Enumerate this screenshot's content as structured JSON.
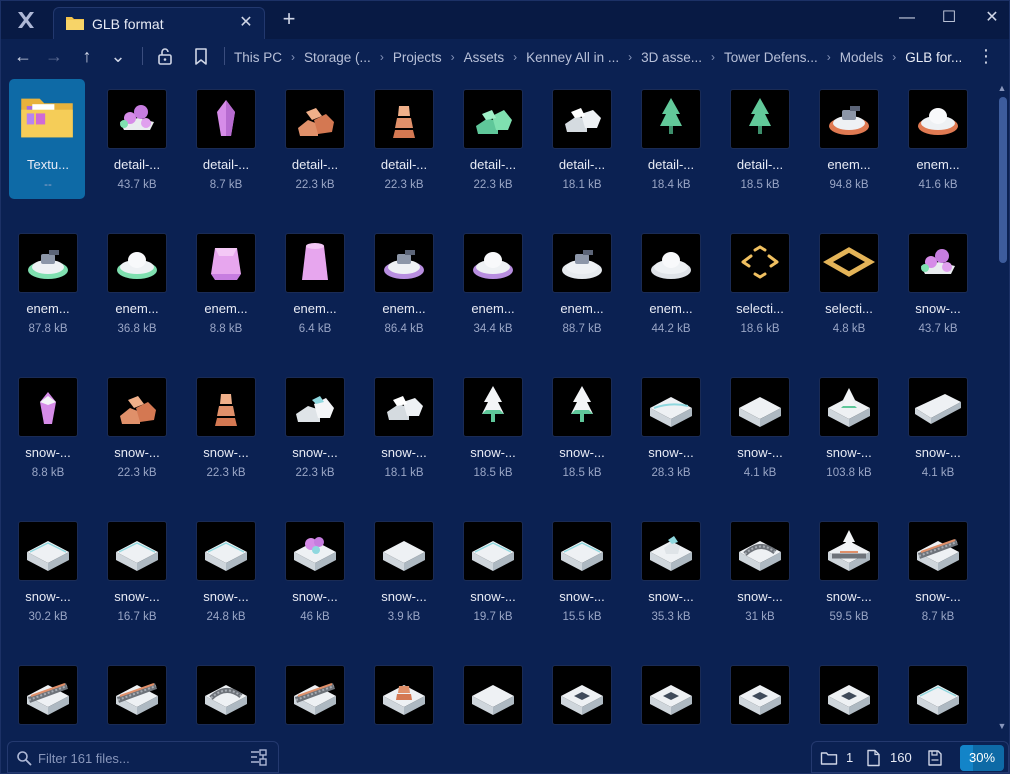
{
  "window": {
    "tab_title": "GLB format",
    "close_tab_glyph": "✕",
    "new_tab_glyph": "+",
    "minimize_glyph": "—",
    "maximize_glyph": "☐",
    "close_glyph": "✕",
    "accent_color": "#0e6aa6",
    "background_color": "#0b2152"
  },
  "toolbar": {
    "back_glyph": "←",
    "forward_glyph": "→",
    "up_glyph": "↑",
    "history_glyph": "⌄",
    "more_glyph": "⋮",
    "breadcrumb": [
      "This PC",
      "Storage (...",
      "Projects",
      "Assets",
      "Kenney All in ...",
      "3D asse...",
      "Tower Defens...",
      "Models",
      "GLB for..."
    ]
  },
  "items": [
    {
      "name": "Textu...",
      "size": "--",
      "kind": "folder",
      "selected": true
    },
    {
      "name": "detail-...",
      "size": "43.7 kB",
      "icon": "crystal-cluster"
    },
    {
      "name": "detail-...",
      "size": "8.7 kB",
      "icon": "crystal"
    },
    {
      "name": "detail-...",
      "size": "22.3 kB",
      "icon": "rocks-orange"
    },
    {
      "name": "detail-...",
      "size": "22.3 kB",
      "icon": "rock-stack-orange"
    },
    {
      "name": "detail-...",
      "size": "22.3 kB",
      "icon": "rocks-green"
    },
    {
      "name": "detail-...",
      "size": "18.1 kB",
      "icon": "rocks-white"
    },
    {
      "name": "detail-...",
      "size": "18.4 kB",
      "icon": "tree-green"
    },
    {
      "name": "detail-...",
      "size": "18.5 kB",
      "icon": "tree-green"
    },
    {
      "name": "enem...",
      "size": "94.8 kB",
      "icon": "ufo-turret"
    },
    {
      "name": "enem...",
      "size": "41.6 kB",
      "icon": "ufo-dome"
    },
    {
      "name": "enem...",
      "size": "87.8 kB",
      "icon": "ufo-turret-green"
    },
    {
      "name": "enem...",
      "size": "36.8 kB",
      "icon": "ufo-green"
    },
    {
      "name": "enem...",
      "size": "8.8 kB",
      "icon": "spawn-pink"
    },
    {
      "name": "enem...",
      "size": "6.4 kB",
      "icon": "pillar-pink"
    },
    {
      "name": "enem...",
      "size": "86.4 kB",
      "icon": "ufo-turret-purple"
    },
    {
      "name": "enem...",
      "size": "34.4 kB",
      "icon": "ufo-purple"
    },
    {
      "name": "enem...",
      "size": "88.7 kB",
      "icon": "ufo-turret-white"
    },
    {
      "name": "enem...",
      "size": "44.2 kB",
      "icon": "ufo-white"
    },
    {
      "name": "selecti...",
      "size": "18.6 kB",
      "icon": "selection-corners"
    },
    {
      "name": "selecti...",
      "size": "4.8 kB",
      "icon": "selection-ring"
    },
    {
      "name": "snow-...",
      "size": "43.7 kB",
      "icon": "crystal-cluster"
    },
    {
      "name": "snow-...",
      "size": "8.8 kB",
      "icon": "crystal-snow"
    },
    {
      "name": "snow-...",
      "size": "22.3 kB",
      "icon": "rocks-orange"
    },
    {
      "name": "snow-...",
      "size": "22.3 kB",
      "icon": "rock-stack-orange"
    },
    {
      "name": "snow-...",
      "size": "22.3 kB",
      "icon": "rocks-snow"
    },
    {
      "name": "snow-...",
      "size": "18.1 kB",
      "icon": "rocks-white"
    },
    {
      "name": "snow-...",
      "size": "18.5 kB",
      "icon": "tree-snow"
    },
    {
      "name": "snow-...",
      "size": "18.5 kB",
      "icon": "tree-snow"
    },
    {
      "name": "snow-...",
      "size": "28.3 kB",
      "icon": "tile-corner-snow"
    },
    {
      "name": "snow-...",
      "size": "4.1 kB",
      "icon": "tile-snow"
    },
    {
      "name": "snow-...",
      "size": "103.8 kB",
      "icon": "tile-tree-snow"
    },
    {
      "name": "snow-...",
      "size": "4.1 kB",
      "icon": "tile-slope-snow"
    },
    {
      "name": "snow-...",
      "size": "30.2 kB",
      "icon": "tile-edge-snow"
    },
    {
      "name": "snow-...",
      "size": "16.7 kB",
      "icon": "tile-edge-snow"
    },
    {
      "name": "snow-...",
      "size": "24.8 kB",
      "icon": "tile-edge-snow"
    },
    {
      "name": "snow-...",
      "size": "46 kB",
      "icon": "tile-crystal-snow"
    },
    {
      "name": "snow-...",
      "size": "3.9 kB",
      "icon": "tile-snow"
    },
    {
      "name": "snow-...",
      "size": "19.7 kB",
      "icon": "tile-edge-snow"
    },
    {
      "name": "snow-...",
      "size": "15.5 kB",
      "icon": "tile-edge-snow"
    },
    {
      "name": "snow-...",
      "size": "35.3 kB",
      "icon": "tile-rocks-snow"
    },
    {
      "name": "snow-...",
      "size": "31 kB",
      "icon": "tile-path-snow"
    },
    {
      "name": "snow-...",
      "size": "59.5 kB",
      "icon": "tile-tree-path-snow"
    },
    {
      "name": "snow-...",
      "size": "8.7 kB",
      "icon": "tile-path-straight-snow"
    },
    {
      "name": "",
      "size": "",
      "icon": "tile-path-straight-snow"
    },
    {
      "name": "",
      "size": "",
      "icon": "tile-path-straight-snow"
    },
    {
      "name": "",
      "size": "",
      "icon": "tile-path-snow"
    },
    {
      "name": "",
      "size": "",
      "icon": "tile-path-straight-snow"
    },
    {
      "name": "",
      "size": "",
      "icon": "tile-rock-stack-snow"
    },
    {
      "name": "",
      "size": "",
      "icon": "tile-snow"
    },
    {
      "name": "",
      "size": "",
      "icon": "tile-hole-snow"
    },
    {
      "name": "",
      "size": "",
      "icon": "tile-hole-snow"
    },
    {
      "name": "",
      "size": "",
      "icon": "tile-hole-snow"
    },
    {
      "name": "",
      "size": "",
      "icon": "tile-hole-snow"
    },
    {
      "name": "",
      "size": "",
      "icon": "tile-edge-snow"
    }
  ],
  "filter": {
    "placeholder": "Filter 161 files..."
  },
  "status": {
    "folders": "1",
    "files": "160",
    "zoom_label": "30%",
    "zoom_fraction": 0.3
  }
}
